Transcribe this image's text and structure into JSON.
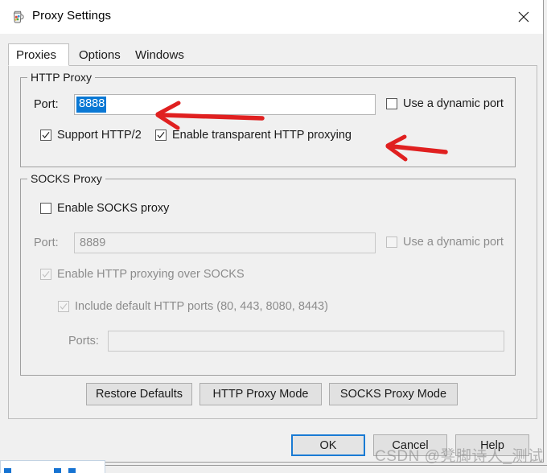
{
  "window": {
    "title": "Proxy Settings",
    "app_icon": "charles-jug-icon",
    "close_icon": "close-icon"
  },
  "tabs": [
    {
      "label": "Proxies",
      "selected": true
    },
    {
      "label": "Options",
      "selected": false
    },
    {
      "label": "Windows",
      "selected": false
    }
  ],
  "http_proxy": {
    "legend": "HTTP Proxy",
    "port_label": "Port:",
    "port_value": "8888",
    "port_selected": true,
    "dynamic_port": {
      "label": "Use a dynamic port",
      "checked": false,
      "enabled": true
    },
    "support_http2": {
      "label": "Support HTTP/2",
      "checked": true,
      "enabled": true
    },
    "transparent_proxying": {
      "label": "Enable transparent HTTP proxying",
      "checked": true,
      "enabled": true
    }
  },
  "socks_proxy": {
    "legend": "SOCKS Proxy",
    "enable_socks": {
      "label": "Enable SOCKS proxy",
      "checked": false,
      "enabled": true
    },
    "port_label": "Port:",
    "port_value": "8889",
    "dynamic_port": {
      "label": "Use a dynamic port",
      "checked": false,
      "enabled": false
    },
    "http_over_socks": {
      "label": "Enable HTTP proxying over SOCKS",
      "checked": true,
      "enabled": false
    },
    "include_default_ports": {
      "label": "Include default HTTP ports (80, 443, 8080, 8443)",
      "checked": true,
      "enabled": false
    },
    "ports_label": "Ports:",
    "ports_value": ""
  },
  "mode_buttons": [
    {
      "label": "Restore Defaults"
    },
    {
      "label": "HTTP Proxy Mode"
    },
    {
      "label": "SOCKS Proxy Mode"
    }
  ],
  "dialog_buttons": [
    {
      "label": "OK",
      "focused": true
    },
    {
      "label": "Cancel",
      "focused": false
    },
    {
      "label": "Help",
      "focused": false
    }
  ],
  "annotations": [
    {
      "name": "arrow-to-port-field",
      "color": "#e02020"
    },
    {
      "name": "arrow-to-transparent-proxying",
      "color": "#e02020"
    }
  ],
  "watermark": {
    "text": "CSDN @凳脚诗人_测试"
  },
  "colors": {
    "selection_blue": "#0a78d4",
    "focus_blue": "#1a7bd4",
    "dialog_grey": "#f0f0f0",
    "annotation_red": "#e02020"
  }
}
